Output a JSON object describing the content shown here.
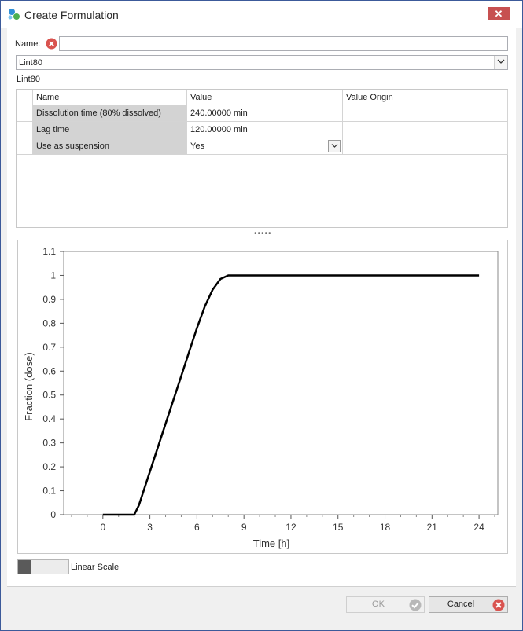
{
  "window": {
    "title": "Create Formulation",
    "close_glyph": "✕"
  },
  "form": {
    "name_label": "Name:",
    "name_value": "",
    "formulation_type": "Lint80",
    "formulation_description": "Lint80"
  },
  "grid": {
    "columns": [
      "Name",
      "Value",
      "Value Origin"
    ],
    "rows": [
      {
        "name": "Dissolution time (80% dissolved)",
        "value": "240.00000 min",
        "origin": ""
      },
      {
        "name": "Lag time",
        "value": "120.00000 min",
        "origin": ""
      },
      {
        "name": "Use as suspension",
        "value": "Yes",
        "origin": ""
      }
    ]
  },
  "splitter": {
    "glyph": "•••••"
  },
  "chart_data": {
    "type": "line",
    "title": "",
    "xlabel": "Time [h]",
    "ylabel": "Fraction (dose)",
    "xlim": [
      -2.5,
      25.2
    ],
    "ylim": [
      0,
      1.1
    ],
    "x_ticks": [
      0,
      3,
      6,
      9,
      12,
      15,
      18,
      21,
      24
    ],
    "y_ticks": [
      0,
      0.1,
      0.2,
      0.3,
      0.4,
      0.5,
      0.6,
      0.7,
      0.8,
      0.9,
      1,
      1.1
    ],
    "y_tick_labels": [
      "0",
      "0.1",
      "0.2",
      "0.3",
      "0.4",
      "0.5",
      "0.6",
      "0.7",
      "0.8",
      "0.9",
      "1",
      "1.1"
    ],
    "grid": false,
    "line_color": "#000000",
    "series": [
      {
        "x": [
          0,
          2,
          2.3,
          3,
          4,
          5,
          5.5,
          6,
          6.5,
          7,
          7.5,
          8,
          9,
          12,
          15,
          18,
          21,
          24
        ],
        "values": [
          0,
          0,
          0.04,
          0.18,
          0.38,
          0.58,
          0.68,
          0.78,
          0.87,
          0.94,
          0.985,
          1,
          1,
          1,
          1,
          1,
          1,
          1
        ]
      }
    ]
  },
  "scale_toggle": {
    "label": "Linear Scale",
    "on": false
  },
  "buttons": {
    "ok": "OK",
    "cancel": "Cancel"
  },
  "colors": {
    "error": "#d9534f",
    "close": "#c75050",
    "accent_blue": "#2f8fd6",
    "accent_green": "#4caf50"
  }
}
